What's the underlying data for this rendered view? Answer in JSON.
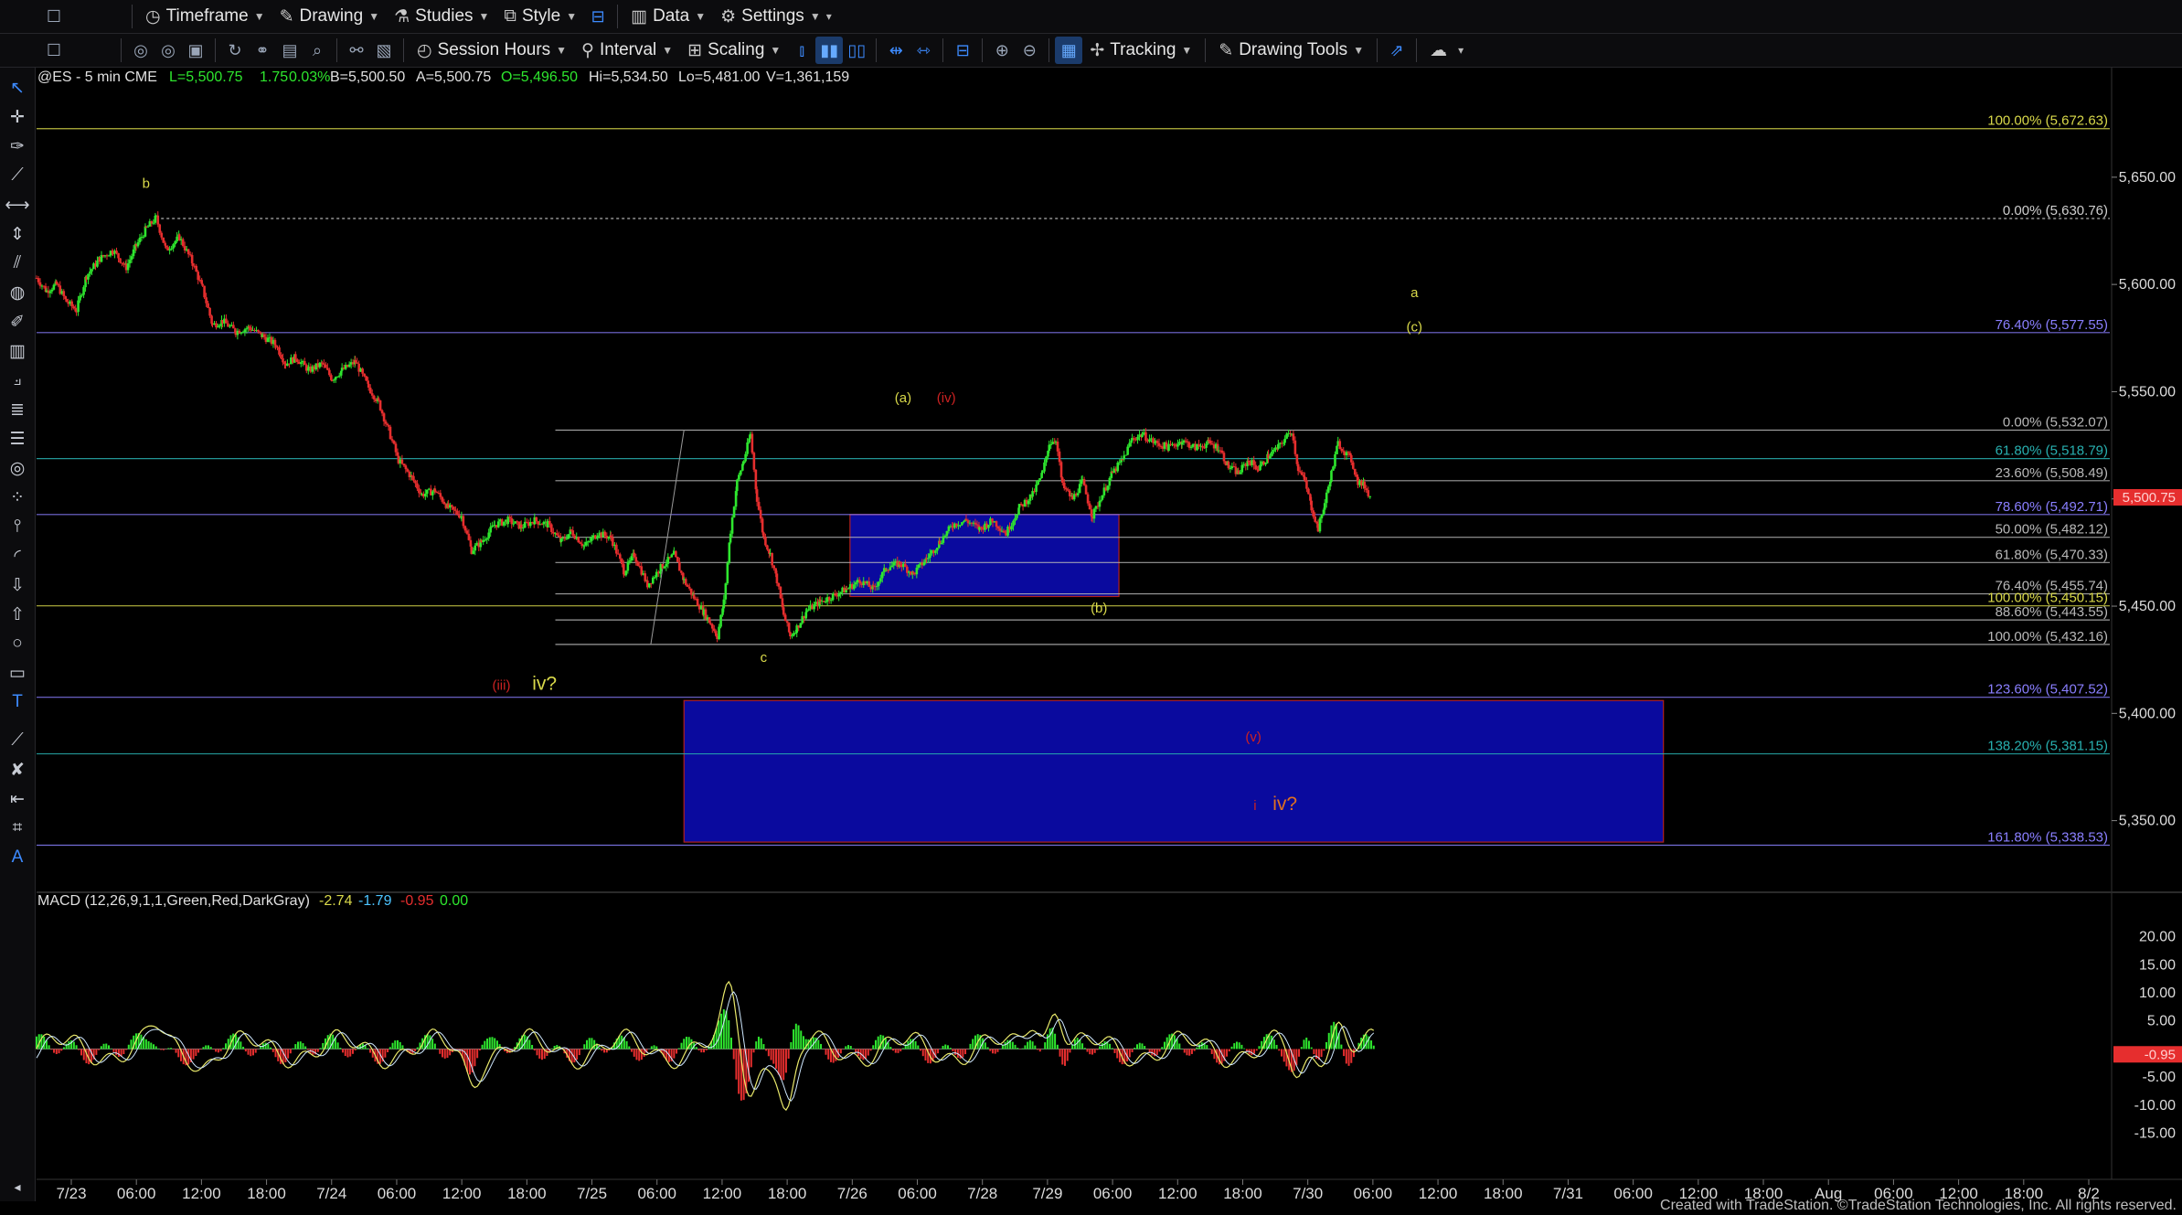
{
  "toolbar_top": {
    "items": [
      {
        "icon": "clock-icon",
        "label": "Timeframe"
      },
      {
        "icon": "pencil-icon",
        "label": "Drawing"
      },
      {
        "icon": "flask-icon",
        "label": "Studies"
      },
      {
        "icon": "style-icon",
        "label": "Style"
      },
      {
        "icon": "bars-icon",
        "label": "Data"
      },
      {
        "icon": "gear-icon",
        "label": "Settings"
      }
    ]
  },
  "toolbar_second": {
    "session_label": "Session Hours",
    "interval_label": "Interval",
    "scaling_label": "Scaling",
    "tracking_label": "Tracking",
    "drawing_tools_label": "Drawing Tools"
  },
  "symbol_bar": {
    "symbol": "@ES - 5 min  CME",
    "last": "L=5,500.75",
    "change": "1.75",
    "change_pct": "0.03%",
    "bid": "B=5,500.50",
    "ask": "A=5,500.75",
    "open": "O=5,496.50",
    "high": "Hi=5,534.50",
    "low": "Lo=5,481.00",
    "volume": "V=1,361,159"
  },
  "macd_bar": {
    "name": "MACD (12,26,9,1,1,Green,Red,DarkGray)",
    "v1": "-2.74",
    "v2": "-1.79",
    "v3": "-0.95",
    "v4": "0.00"
  },
  "footer": "Created with TradeStation. ©TradeStation Technologies, Inc. All rights reserved.",
  "colors": {
    "up": "#2ee62e",
    "down": "#e62e2e",
    "yellow": "#d9d94a",
    "purple": "#8a7fff",
    "red": "#cc2222",
    "blue_box": "#0a0a9e"
  },
  "chart_data": {
    "type": "candlestick",
    "price_axis": {
      "ylim": [
        5320,
        5690
      ],
      "ticks": [
        "5,650.00",
        "5,600.00",
        "5,550.00",
        "5,500.00",
        "5,450.00",
        "5,400.00",
        "5,350.00"
      ],
      "tick_values": [
        5650,
        5600,
        5550,
        5500,
        5450,
        5400,
        5350
      ]
    },
    "last_price_label": "5,500.75",
    "last_price": 5500.75,
    "macd_axis": {
      "ylim": [
        -18,
        24
      ],
      "ticks": [
        "20.00",
        "15.00",
        "10.00",
        "5.00",
        "-5.00",
        "-10.00",
        "-15.00"
      ],
      "tick_values": [
        20,
        15,
        10,
        5,
        -5,
        -10,
        -15
      ],
      "current_label": "-0.95",
      "current": -0.95
    },
    "time_axis": {
      "labels": [
        "7/23",
        "06:00",
        "12:00",
        "18:00",
        "7/24",
        "06:00",
        "12:00",
        "18:00",
        "7/25",
        "06:00",
        "12:00",
        "18:00",
        "7/26",
        "06:00",
        "7/28",
        "7/29",
        "06:00",
        "12:00",
        "18:00",
        "7/30",
        "06:00",
        "12:00",
        "18:00",
        "7/31",
        "06:00",
        "12:00",
        "18:00",
        "Aug",
        "06:00",
        "12:00",
        "18:00",
        "8/2"
      ]
    },
    "price_path": [
      [
        0,
        5603
      ],
      [
        6,
        5597
      ],
      [
        12,
        5600
      ],
      [
        18,
        5592
      ],
      [
        24,
        5588
      ],
      [
        30,
        5604
      ],
      [
        38,
        5612
      ],
      [
        46,
        5616
      ],
      [
        54,
        5608
      ],
      [
        60,
        5618
      ],
      [
        66,
        5626
      ],
      [
        72,
        5631
      ],
      [
        78,
        5616
      ],
      [
        86,
        5622
      ],
      [
        94,
        5610
      ],
      [
        100,
        5598
      ],
      [
        106,
        5581
      ],
      [
        112,
        5583
      ],
      [
        120,
        5578
      ],
      [
        128,
        5580
      ],
      [
        136,
        5576
      ],
      [
        144,
        5572
      ],
      [
        150,
        5563
      ],
      [
        156,
        5566
      ],
      [
        164,
        5560
      ],
      [
        172,
        5563
      ],
      [
        178,
        5556
      ],
      [
        184,
        5560
      ],
      [
        192,
        5564
      ],
      [
        200,
        5552
      ],
      [
        206,
        5545
      ],
      [
        212,
        5532
      ],
      [
        218,
        5518
      ],
      [
        226,
        5510
      ],
      [
        232,
        5502
      ],
      [
        240,
        5504
      ],
      [
        248,
        5496
      ],
      [
        256,
        5492
      ],
      [
        262,
        5476
      ],
      [
        268,
        5480
      ],
      [
        276,
        5488
      ],
      [
        284,
        5490
      ],
      [
        292,
        5487
      ],
      [
        300,
        5490
      ],
      [
        308,
        5488
      ],
      [
        316,
        5480
      ],
      [
        322,
        5485
      ],
      [
        330,
        5478
      ],
      [
        338,
        5484
      ],
      [
        346,
        5482
      ],
      [
        354,
        5466
      ],
      [
        360,
        5474
      ],
      [
        368,
        5460
      ],
      [
        376,
        5468
      ],
      [
        384,
        5474
      ],
      [
        390,
        5462
      ],
      [
        396,
        5454
      ],
      [
        402,
        5447
      ],
      [
        406,
        5442
      ],
      [
        410,
        5436
      ],
      [
        414,
        5452
      ],
      [
        418,
        5485
      ],
      [
        422,
        5508
      ],
      [
        426,
        5518
      ],
      [
        430,
        5530
      ],
      [
        434,
        5500
      ],
      [
        438,
        5482
      ],
      [
        442,
        5474
      ],
      [
        446,
        5462
      ],
      [
        450,
        5446
      ],
      [
        454,
        5436
      ],
      [
        458,
        5440
      ],
      [
        464,
        5448
      ],
      [
        472,
        5452
      ],
      [
        480,
        5455
      ],
      [
        488,
        5458
      ],
      [
        496,
        5462
      ],
      [
        504,
        5458
      ],
      [
        512,
        5468
      ],
      [
        520,
        5470
      ],
      [
        528,
        5465
      ],
      [
        536,
        5472
      ],
      [
        544,
        5480
      ],
      [
        552,
        5488
      ],
      [
        560,
        5490
      ],
      [
        568,
        5486
      ],
      [
        576,
        5490
      ],
      [
        584,
        5484
      ],
      [
        592,
        5496
      ],
      [
        600,
        5502
      ],
      [
        606,
        5512
      ],
      [
        610,
        5526
      ],
      [
        614,
        5528
      ],
      [
        618,
        5506
      ],
      [
        624,
        5500
      ],
      [
        630,
        5508
      ],
      [
        636,
        5492
      ],
      [
        642,
        5502
      ],
      [
        648,
        5512
      ],
      [
        654,
        5518
      ],
      [
        660,
        5528
      ],
      [
        666,
        5530
      ],
      [
        674,
        5526
      ],
      [
        682,
        5524
      ],
      [
        690,
        5527
      ],
      [
        698,
        5524
      ],
      [
        706,
        5526
      ],
      [
        712,
        5524
      ],
      [
        718,
        5515
      ],
      [
        724,
        5512
      ],
      [
        730,
        5518
      ],
      [
        736,
        5514
      ],
      [
        742,
        5520
      ],
      [
        748,
        5524
      ],
      [
        752,
        5528
      ],
      [
        756,
        5532
      ],
      [
        760,
        5514
      ],
      [
        764,
        5508
      ],
      [
        768,
        5496
      ],
      [
        772,
        5486
      ],
      [
        776,
        5498
      ],
      [
        780,
        5512
      ],
      [
        784,
        5526
      ],
      [
        788,
        5522
      ],
      [
        792,
        5518
      ],
      [
        796,
        5508
      ],
      [
        800,
        5506
      ],
      [
        804,
        5500
      ]
    ],
    "fib_levels": [
      {
        "label": "100.00% (5,672.63)",
        "value": 5672.63,
        "color": "#d9d94a",
        "x0": 0,
        "x1": 1.0
      },
      {
        "label": "0.00% (5,630.76)",
        "value": 5630.76,
        "color": "#cfcfcf",
        "x0": 0.06,
        "x1": 1.0,
        "dashed": true
      },
      {
        "label": "76.40% (5,577.55)",
        "value": 5577.55,
        "color": "#8a7fff",
        "x0": 0,
        "x1": 1.0
      },
      {
        "label": "0.00% (5,532.07)",
        "value": 5532.07,
        "color": "#b8b8b8",
        "x0": 0.25,
        "x1": 1.0
      },
      {
        "label": "61.80% (5,518.79)",
        "value": 5518.79,
        "color": "#28b0b0",
        "x0": 0,
        "x1": 1.0
      },
      {
        "label": "23.60% (5,508.49)",
        "value": 5508.49,
        "color": "#b8b8b8",
        "x0": 0.25,
        "x1": 1.0
      },
      {
        "label": "78.60% (5,492.71)",
        "value": 5492.71,
        "color": "#8a7fff",
        "x0": 0,
        "x1": 1.0
      },
      {
        "label": "50.00% (5,482.12)",
        "value": 5482.12,
        "color": "#b8b8b8",
        "x0": 0.25,
        "x1": 1.0
      },
      {
        "label": "61.80% (5,470.33)",
        "value": 5470.33,
        "color": "#b8b8b8",
        "x0": 0.25,
        "x1": 1.0
      },
      {
        "label": "76.40% (5,455.74)",
        "value": 5455.74,
        "color": "#b8b8b8",
        "x0": 0.25,
        "x1": 1.0
      },
      {
        "label": "100.00% (5,450.15)",
        "value": 5450.15,
        "color": "#d9d94a",
        "x0": 0,
        "x1": 1.0
      },
      {
        "label": "88.60% (5,443.55)",
        "value": 5443.55,
        "color": "#b8b8b8",
        "x0": 0.25,
        "x1": 1.0
      },
      {
        "label": "100.00% (5,432.16)",
        "value": 5432.16,
        "color": "#b8b8b8",
        "x0": 0.25,
        "x1": 1.0
      },
      {
        "label": "123.60% (5,407.52)",
        "value": 5407.52,
        "color": "#8a7fff",
        "x0": 0,
        "x1": 1.0
      },
      {
        "label": "138.20% (5,381.15)",
        "value": 5381.15,
        "color": "#28b0b0",
        "x0": 0,
        "x1": 1.0
      },
      {
        "label": "161.80% (5,338.53)",
        "value": 5338.53,
        "color": "#8a7fff",
        "x0": 0,
        "x1": 1.0
      }
    ],
    "boxes": [
      {
        "top": 5492.71,
        "bottom": 5454.5,
        "t0": 490,
        "t1": 652
      },
      {
        "top": 5406,
        "bottom": 5340,
        "t0": 390,
        "t1": 980
      }
    ],
    "wave_labels": [
      {
        "text": "b",
        "t": 66,
        "price": 5645,
        "color": "#d9d94a"
      },
      {
        "text": "c",
        "t": 438,
        "price": 5424,
        "color": "#d9d94a"
      },
      {
        "text": "(iii)",
        "t": 280,
        "price": 5411,
        "color": "#cc2222"
      },
      {
        "text": "iv?",
        "t": 306,
        "price": 5411,
        "color": "#d9d94a",
        "big": true
      },
      {
        "text": "(a)",
        "t": 522,
        "price": 5545,
        "color": "#d9d94a"
      },
      {
        "text": "(iv)",
        "t": 548,
        "price": 5545,
        "color": "#cc2222"
      },
      {
        "text": "(b)",
        "t": 640,
        "price": 5447,
        "color": "#d9d94a"
      },
      {
        "text": "a",
        "t": 830,
        "price": 5594,
        "color": "#d9d94a"
      },
      {
        "text": "(c)",
        "t": 830,
        "price": 5578,
        "color": "#d9d94a"
      },
      {
        "text": "(v)",
        "t": 733,
        "price": 5387,
        "color": "#cc2222"
      },
      {
        "text": "i",
        "t": 734,
        "price": 5355,
        "color": "#cc2222"
      },
      {
        "text": "iv?",
        "t": 752,
        "price": 5355,
        "color": "#e07020",
        "big": true
      }
    ]
  }
}
